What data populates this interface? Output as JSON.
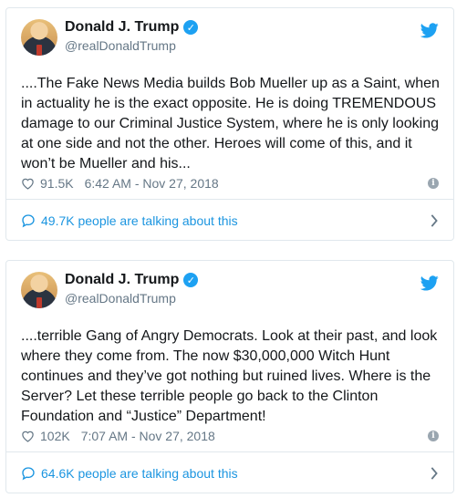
{
  "tweets": [
    {
      "name": "Donald J. Trump",
      "handle": "@realDonaldTrump",
      "text": "....The Fake News Media builds Bob Mueller up as a Saint, when in actuality he is the exact opposite. He is doing TREMENDOUS damage to our Criminal Justice System, where he is only looking at one side and not the other. Heroes will come of this, and it won’t be Mueller and his...",
      "likes": "91.5K",
      "timestamp": "6:42 AM - Nov 27, 2018",
      "talking": "49.7K people are talking about this"
    },
    {
      "name": "Donald J. Trump",
      "handle": "@realDonaldTrump",
      "text": "....terrible Gang of Angry Democrats. Look at their past, and look where they come from. The now $30,000,000 Witch Hunt continues and they’ve got nothing but ruined lives. Where is the Server? Let these terrible people go back to the Clinton Foundation and “Justice” Department!",
      "likes": "102K",
      "timestamp": "7:07 AM - Nov 27, 2018",
      "talking": "64.6K people are talking about this"
    }
  ],
  "icons": {
    "verified": "verified-badge-icon",
    "logo": "twitter-bird-icon",
    "like": "heart-icon",
    "info": "info-icon",
    "conversation": "speech-bubble-icon",
    "more": "chevron-right-icon"
  },
  "colors": {
    "accent": "#1da1f2",
    "link": "#1b95e0",
    "muted": "#657786",
    "border": "#e1e8ed"
  }
}
